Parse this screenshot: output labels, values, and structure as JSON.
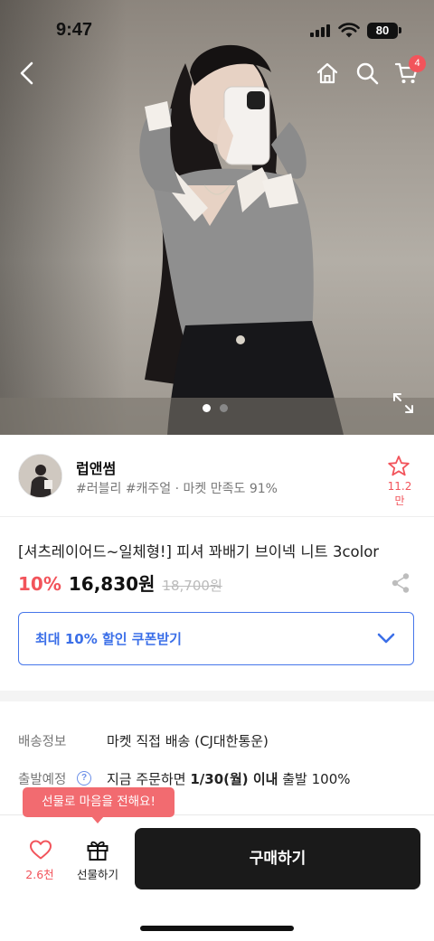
{
  "status_bar": {
    "time": "9:47",
    "battery": "80"
  },
  "nav": {
    "cart_count": "4"
  },
  "carousel": {
    "total": 2,
    "active": 1
  },
  "seller": {
    "name": "럽앤썸",
    "tags": "#러블리 #캐주얼 · 마켓 만족도 91%",
    "favorites": "11.2만"
  },
  "product": {
    "title": "[셔츠레이어드~일체형!] 피셔 꽈배기 브이넥 니트 3color",
    "discount": "10%",
    "price": "16,830원",
    "original_price": "18,700원"
  },
  "coupon": {
    "label": "최대 10% 할인 쿠폰받기"
  },
  "info": {
    "shipping_label": "배송정보",
    "shipping_value": "마켓 직접 배송 (CJ대한통운)",
    "departure_label": "출발예정",
    "departure_prefix": "지금 주문하면 ",
    "departure_date": "1/30(월) 이내",
    "departure_suffix": " 출발 100%",
    "help_mark": "?"
  },
  "bottom_bar": {
    "tooltip": "선물로 마음을 전해요!",
    "like_count": "2.6천",
    "gift_label": "선물하기",
    "buy_label": "구매하기"
  },
  "colors": {
    "accent": "#f2545b",
    "coupon_blue": "#3b6fe8",
    "buy_button": "#1a1a1a"
  }
}
